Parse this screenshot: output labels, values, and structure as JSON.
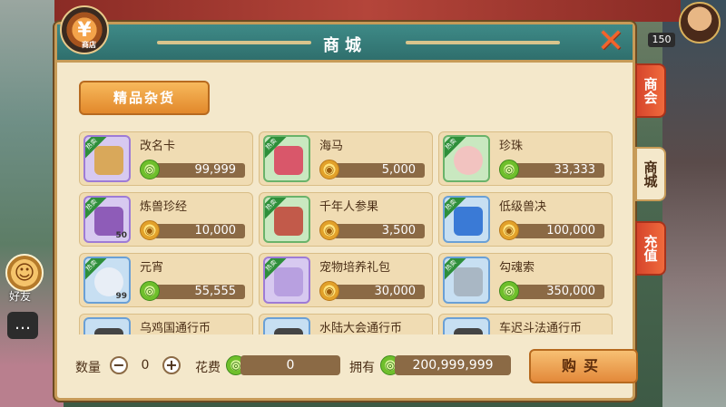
{
  "hud": {
    "level": "150",
    "friend_label": "好友"
  },
  "window": {
    "title": "商城",
    "emblem_symbol": "¥",
    "emblem_caption": "商店"
  },
  "category": {
    "label": "精品杂货"
  },
  "items": [
    {
      "name": "改名卡",
      "price": "99,999",
      "currency": "green",
      "hot": true,
      "qty": ""
    },
    {
      "name": "海马",
      "price": "5,000",
      "currency": "gold",
      "hot": true,
      "qty": ""
    },
    {
      "name": "珍珠",
      "price": "33,333",
      "currency": "green",
      "hot": true,
      "qty": ""
    },
    {
      "name": "炼兽珍经",
      "price": "10,000",
      "currency": "gold",
      "hot": true,
      "qty": "50"
    },
    {
      "name": "千年人参果",
      "price": "3,500",
      "currency": "gold",
      "hot": true,
      "qty": ""
    },
    {
      "name": "低级兽决",
      "price": "100,000",
      "currency": "gold",
      "hot": true,
      "qty": ""
    },
    {
      "name": "元宵",
      "price": "55,555",
      "currency": "green",
      "hot": true,
      "qty": "99"
    },
    {
      "name": "宠物培养礼包",
      "price": "30,000",
      "currency": "gold",
      "hot": true,
      "qty": ""
    },
    {
      "name": "勾魂索",
      "price": "350,000",
      "currency": "green",
      "hot": true,
      "qty": ""
    },
    {
      "name": "乌鸡国通行币",
      "price": "",
      "currency": "green",
      "hot": false,
      "qty": ""
    },
    {
      "name": "水陆大会通行币",
      "price": "",
      "currency": "green",
      "hot": false,
      "qty": ""
    },
    {
      "name": "车迟斗法通行币",
      "price": "",
      "currency": "green",
      "hot": false,
      "qty": ""
    }
  ],
  "hot_tag": "热卖",
  "bottom": {
    "qty_label": "数量",
    "qty_value": "0",
    "cost_label": "花费",
    "cost_value": "0",
    "own_label": "拥有",
    "own_value": "200,999,999",
    "buy_label": "购买"
  },
  "tabs": [
    {
      "label": "商会",
      "active": false
    },
    {
      "label": "商城",
      "active": true
    },
    {
      "label": "充值",
      "active": false
    }
  ],
  "colors": {
    "accent": "#e2882b",
    "panel": "#f4e8cb",
    "titlebar": "#2f6f6d"
  }
}
